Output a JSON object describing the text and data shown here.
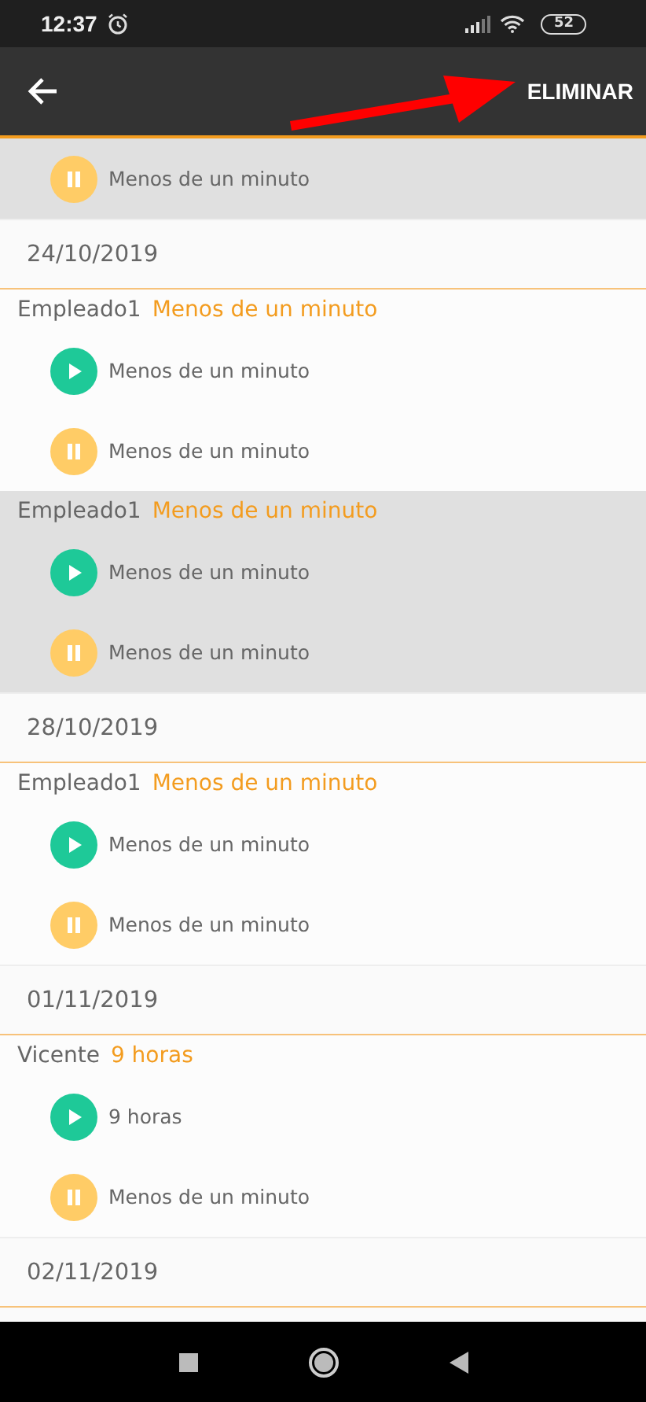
{
  "status_bar": {
    "time": "12:37",
    "battery": "52"
  },
  "toolbar": {
    "action": "ELIMINAR"
  },
  "leading_group": {
    "selected": true,
    "entries": [
      {
        "kind": "pause",
        "duration": "Menos de un minuto"
      }
    ]
  },
  "days": [
    {
      "date": "24/10/2019",
      "groups": [
        {
          "employee": "Empleado1",
          "total": "Menos de un minuto",
          "selected": false,
          "entries": [
            {
              "kind": "play",
              "duration": "Menos de un minuto"
            },
            {
              "kind": "pause",
              "duration": "Menos de un minuto"
            }
          ]
        },
        {
          "employee": "Empleado1",
          "total": "Menos de un minuto",
          "selected": true,
          "entries": [
            {
              "kind": "play",
              "duration": "Menos de un minuto"
            },
            {
              "kind": "pause",
              "duration": "Menos de un minuto"
            }
          ]
        }
      ]
    },
    {
      "date": "28/10/2019",
      "groups": [
        {
          "employee": "Empleado1",
          "total": "Menos de un minuto",
          "selected": false,
          "entries": [
            {
              "kind": "play",
              "duration": "Menos de un minuto"
            },
            {
              "kind": "pause",
              "duration": "Menos de un minuto"
            }
          ]
        }
      ]
    },
    {
      "date": "01/11/2019",
      "groups": [
        {
          "employee": "Vicente",
          "total": "9 horas",
          "selected": false,
          "entries": [
            {
              "kind": "play",
              "duration": "9 horas"
            },
            {
              "kind": "pause",
              "duration": "Menos de un minuto"
            }
          ]
        }
      ]
    },
    {
      "date": "02/11/2019"
    }
  ]
}
